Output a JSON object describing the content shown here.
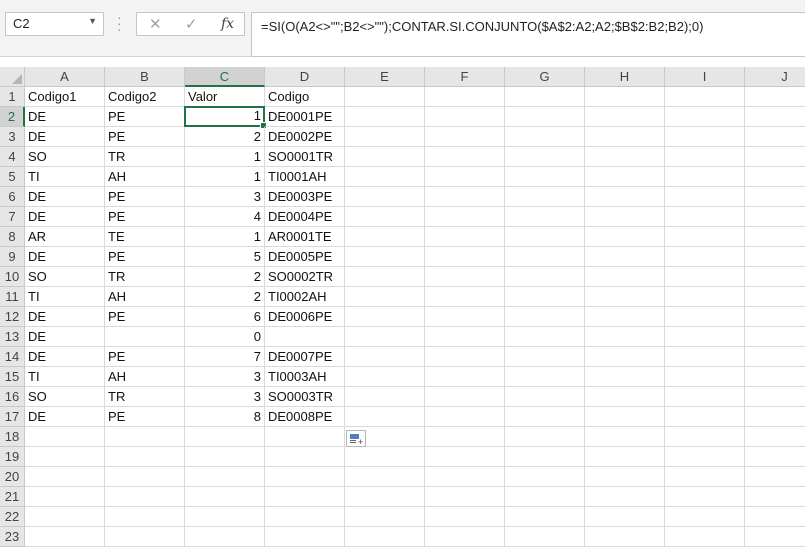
{
  "name_box": {
    "value": "C2"
  },
  "formula_bar": {
    "cancel_glyph": "✕",
    "enter_glyph": "✓",
    "fx_label": "fx",
    "formula": "=SI(O(A2<>\"\";B2<>\"\");CONTAR.SI.CONJUNTO($A$2:A2;A2;$B$2:B2;B2);0)"
  },
  "selection": {
    "column": "C",
    "row": 2
  },
  "columns": [
    "A",
    "B",
    "C",
    "D",
    "E",
    "F",
    "G",
    "H",
    "I",
    "J"
  ],
  "row_numbers": [
    "1",
    "2",
    "3",
    "4",
    "5",
    "6",
    "7",
    "8",
    "9",
    "10",
    "11",
    "12",
    "13",
    "14",
    "15",
    "16",
    "17",
    "18",
    "19",
    "20",
    "21",
    "22",
    "23"
  ],
  "rows": [
    [
      "Codigo1",
      "Codigo2",
      "Valor",
      "Codigo"
    ],
    [
      "DE",
      "PE",
      "1",
      "DE0001PE"
    ],
    [
      "DE",
      "PE",
      "2",
      "DE0002PE"
    ],
    [
      "SO",
      "TR",
      "1",
      "SO0001TR"
    ],
    [
      "TI",
      "AH",
      "1",
      "TI0001AH"
    ],
    [
      "DE",
      "PE",
      "3",
      "DE0003PE"
    ],
    [
      "DE",
      "PE",
      "4",
      "DE0004PE"
    ],
    [
      "AR",
      "TE",
      "1",
      "AR0001TE"
    ],
    [
      "DE",
      "PE",
      "5",
      "DE0005PE"
    ],
    [
      "SO",
      "TR",
      "2",
      "SO0002TR"
    ],
    [
      "TI",
      "AH",
      "2",
      "TI0002AH"
    ],
    [
      "DE",
      "PE",
      "6",
      "DE0006PE"
    ],
    [
      "DE",
      "",
      "0",
      ""
    ],
    [
      "DE",
      "PE",
      "7",
      "DE0007PE"
    ],
    [
      "TI",
      "AH",
      "3",
      "TI0003AH"
    ],
    [
      "SO",
      "TR",
      "3",
      "SO0003TR"
    ],
    [
      "DE",
      "PE",
      "8",
      "DE0008PE"
    ]
  ],
  "colors": {
    "accent": "#217346",
    "header_bg": "#e6e6e6",
    "gridline": "#dadada"
  }
}
